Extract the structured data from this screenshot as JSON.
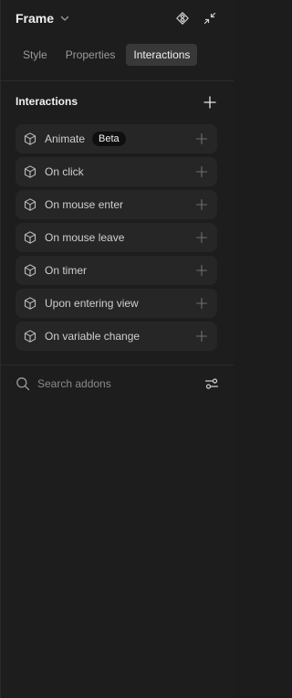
{
  "header": {
    "title": "Frame"
  },
  "tabs": [
    {
      "label": "Style",
      "active": false
    },
    {
      "label": "Properties",
      "active": false
    },
    {
      "label": "Interactions",
      "active": true
    }
  ],
  "section": {
    "title": "Interactions"
  },
  "interactions": [
    {
      "label": "Animate",
      "badge": "Beta"
    },
    {
      "label": "On click"
    },
    {
      "label": "On mouse enter"
    },
    {
      "label": "On mouse leave"
    },
    {
      "label": "On timer"
    },
    {
      "label": "Upon entering view"
    },
    {
      "label": "On variable change"
    }
  ],
  "search": {
    "placeholder": "Search addons",
    "value": ""
  },
  "colors": {
    "background": "#1d1d1d",
    "row": "#262626",
    "active_tab": "#383838",
    "text": "#f0f0f0",
    "muted": "#8a8a8a"
  },
  "icons": {
    "chevron": "chevron-down-icon",
    "component": "component-diamond-icon",
    "collapse": "collapse-arrows-icon",
    "add": "plus-icon",
    "cube": "cube-icon",
    "search": "search-icon",
    "filter": "filter-sliders-icon"
  }
}
